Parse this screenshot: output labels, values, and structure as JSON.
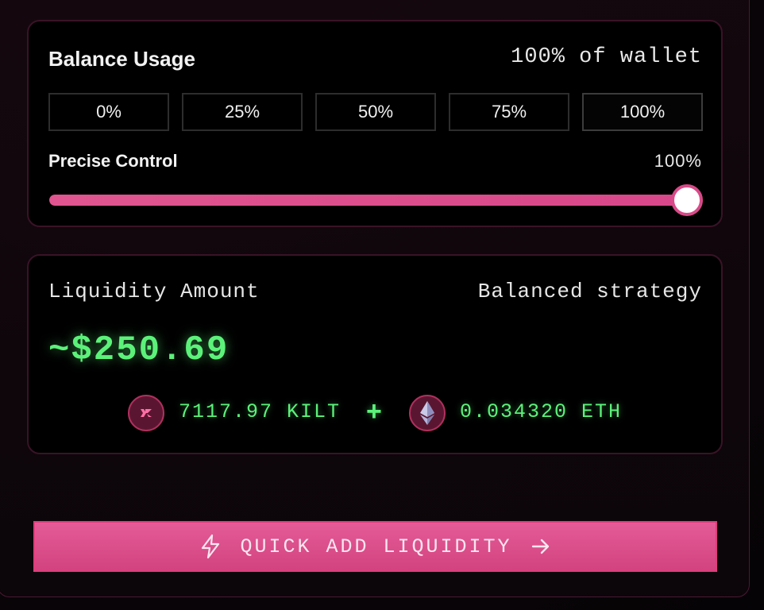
{
  "balance_usage": {
    "title": "Balance Usage",
    "wallet_percent": "100% of wallet",
    "percent_options": [
      "0%",
      "25%",
      "50%",
      "75%",
      "100%"
    ],
    "selected_option": "100%",
    "precise_control_label": "Precise Control",
    "precise_control_value": "100%",
    "slider_fraction": 1.0
  },
  "liquidity": {
    "label": "Liquidity Amount",
    "strategy": "Balanced strategy",
    "amount": "~$250.69",
    "token_a": {
      "icon": "kilt-icon",
      "amount": "7117.97 KILT"
    },
    "plus": "+",
    "token_b": {
      "icon": "eth-icon",
      "amount": "0.034320 ETH"
    }
  },
  "cta": {
    "label": "QUICK ADD LIQUIDITY",
    "left_icon": "lightning-icon",
    "right_icon": "arrow-right-icon"
  },
  "colors": {
    "accent_pink": "#d8478a",
    "value_green": "#5cf27a",
    "card_border": "#3a1326"
  }
}
